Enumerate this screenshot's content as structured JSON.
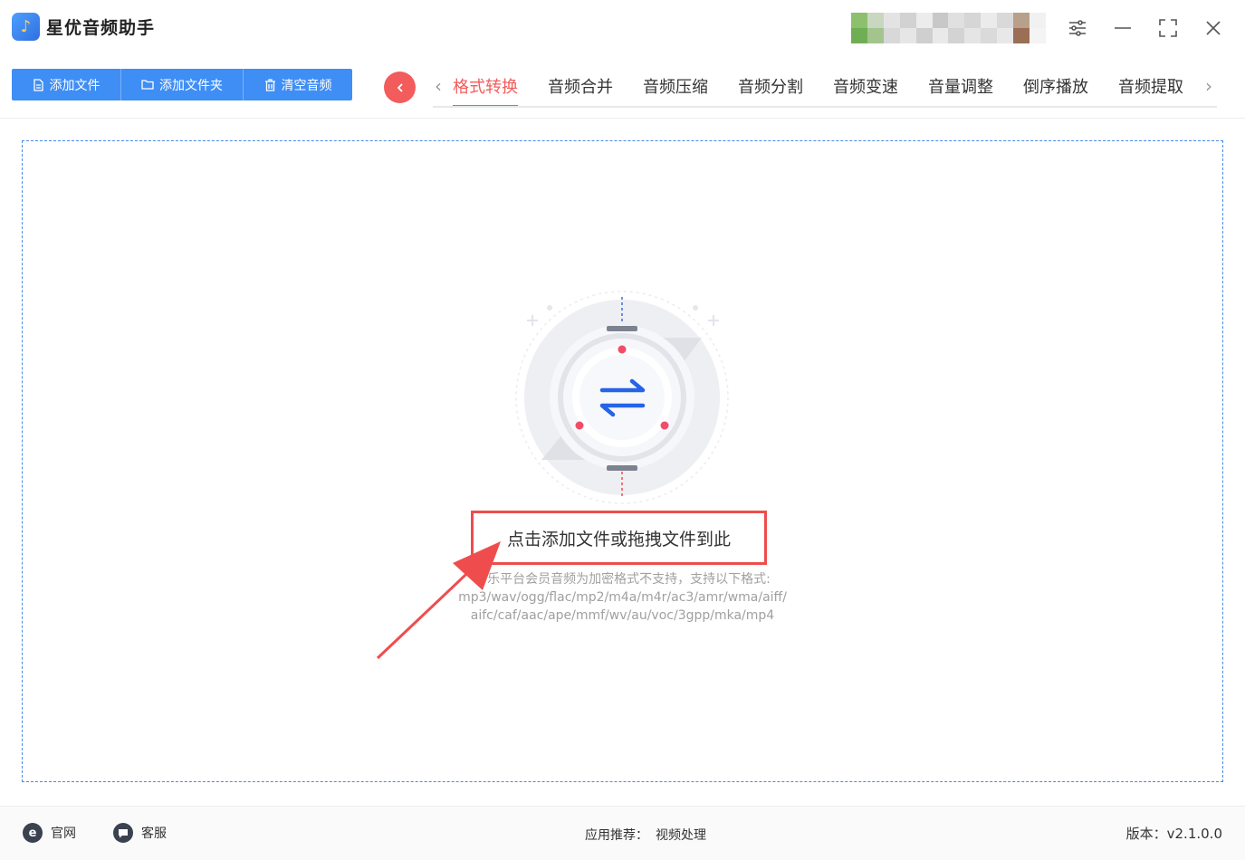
{
  "app": {
    "title": "星优音频助手"
  },
  "toolbar": {
    "add_file": "添加文件",
    "add_folder": "添加文件夹",
    "clear": "清空音频"
  },
  "tabs": [
    "格式转换",
    "音频合并",
    "音频压缩",
    "音频分割",
    "音频变速",
    "音量调整",
    "倒序播放",
    "音频提取"
  ],
  "active_tab": "格式转换",
  "dropzone": {
    "cta": "点击添加文件或拖拽文件到此",
    "hint_lines": [
      "音乐平台会员音频为加密格式不支持，支持以下格式:",
      "mp3/wav/ogg/flac/mp2/m4a/m4r/ac3/amr/wma/aiff/",
      "aifc/caf/aac/ape/mmf/wv/au/voc/3gpp/mka/mp4"
    ]
  },
  "footer": {
    "website": "官网",
    "support": "客服",
    "recommend_label": "应用推荐：",
    "recommend_link": "视频处理",
    "version": "版本：v2.1.0.0"
  },
  "colors": {
    "accent_blue": "#3f8ef5",
    "accent_red": "#f25c5c",
    "annotation_red": "#ef4d4d"
  }
}
